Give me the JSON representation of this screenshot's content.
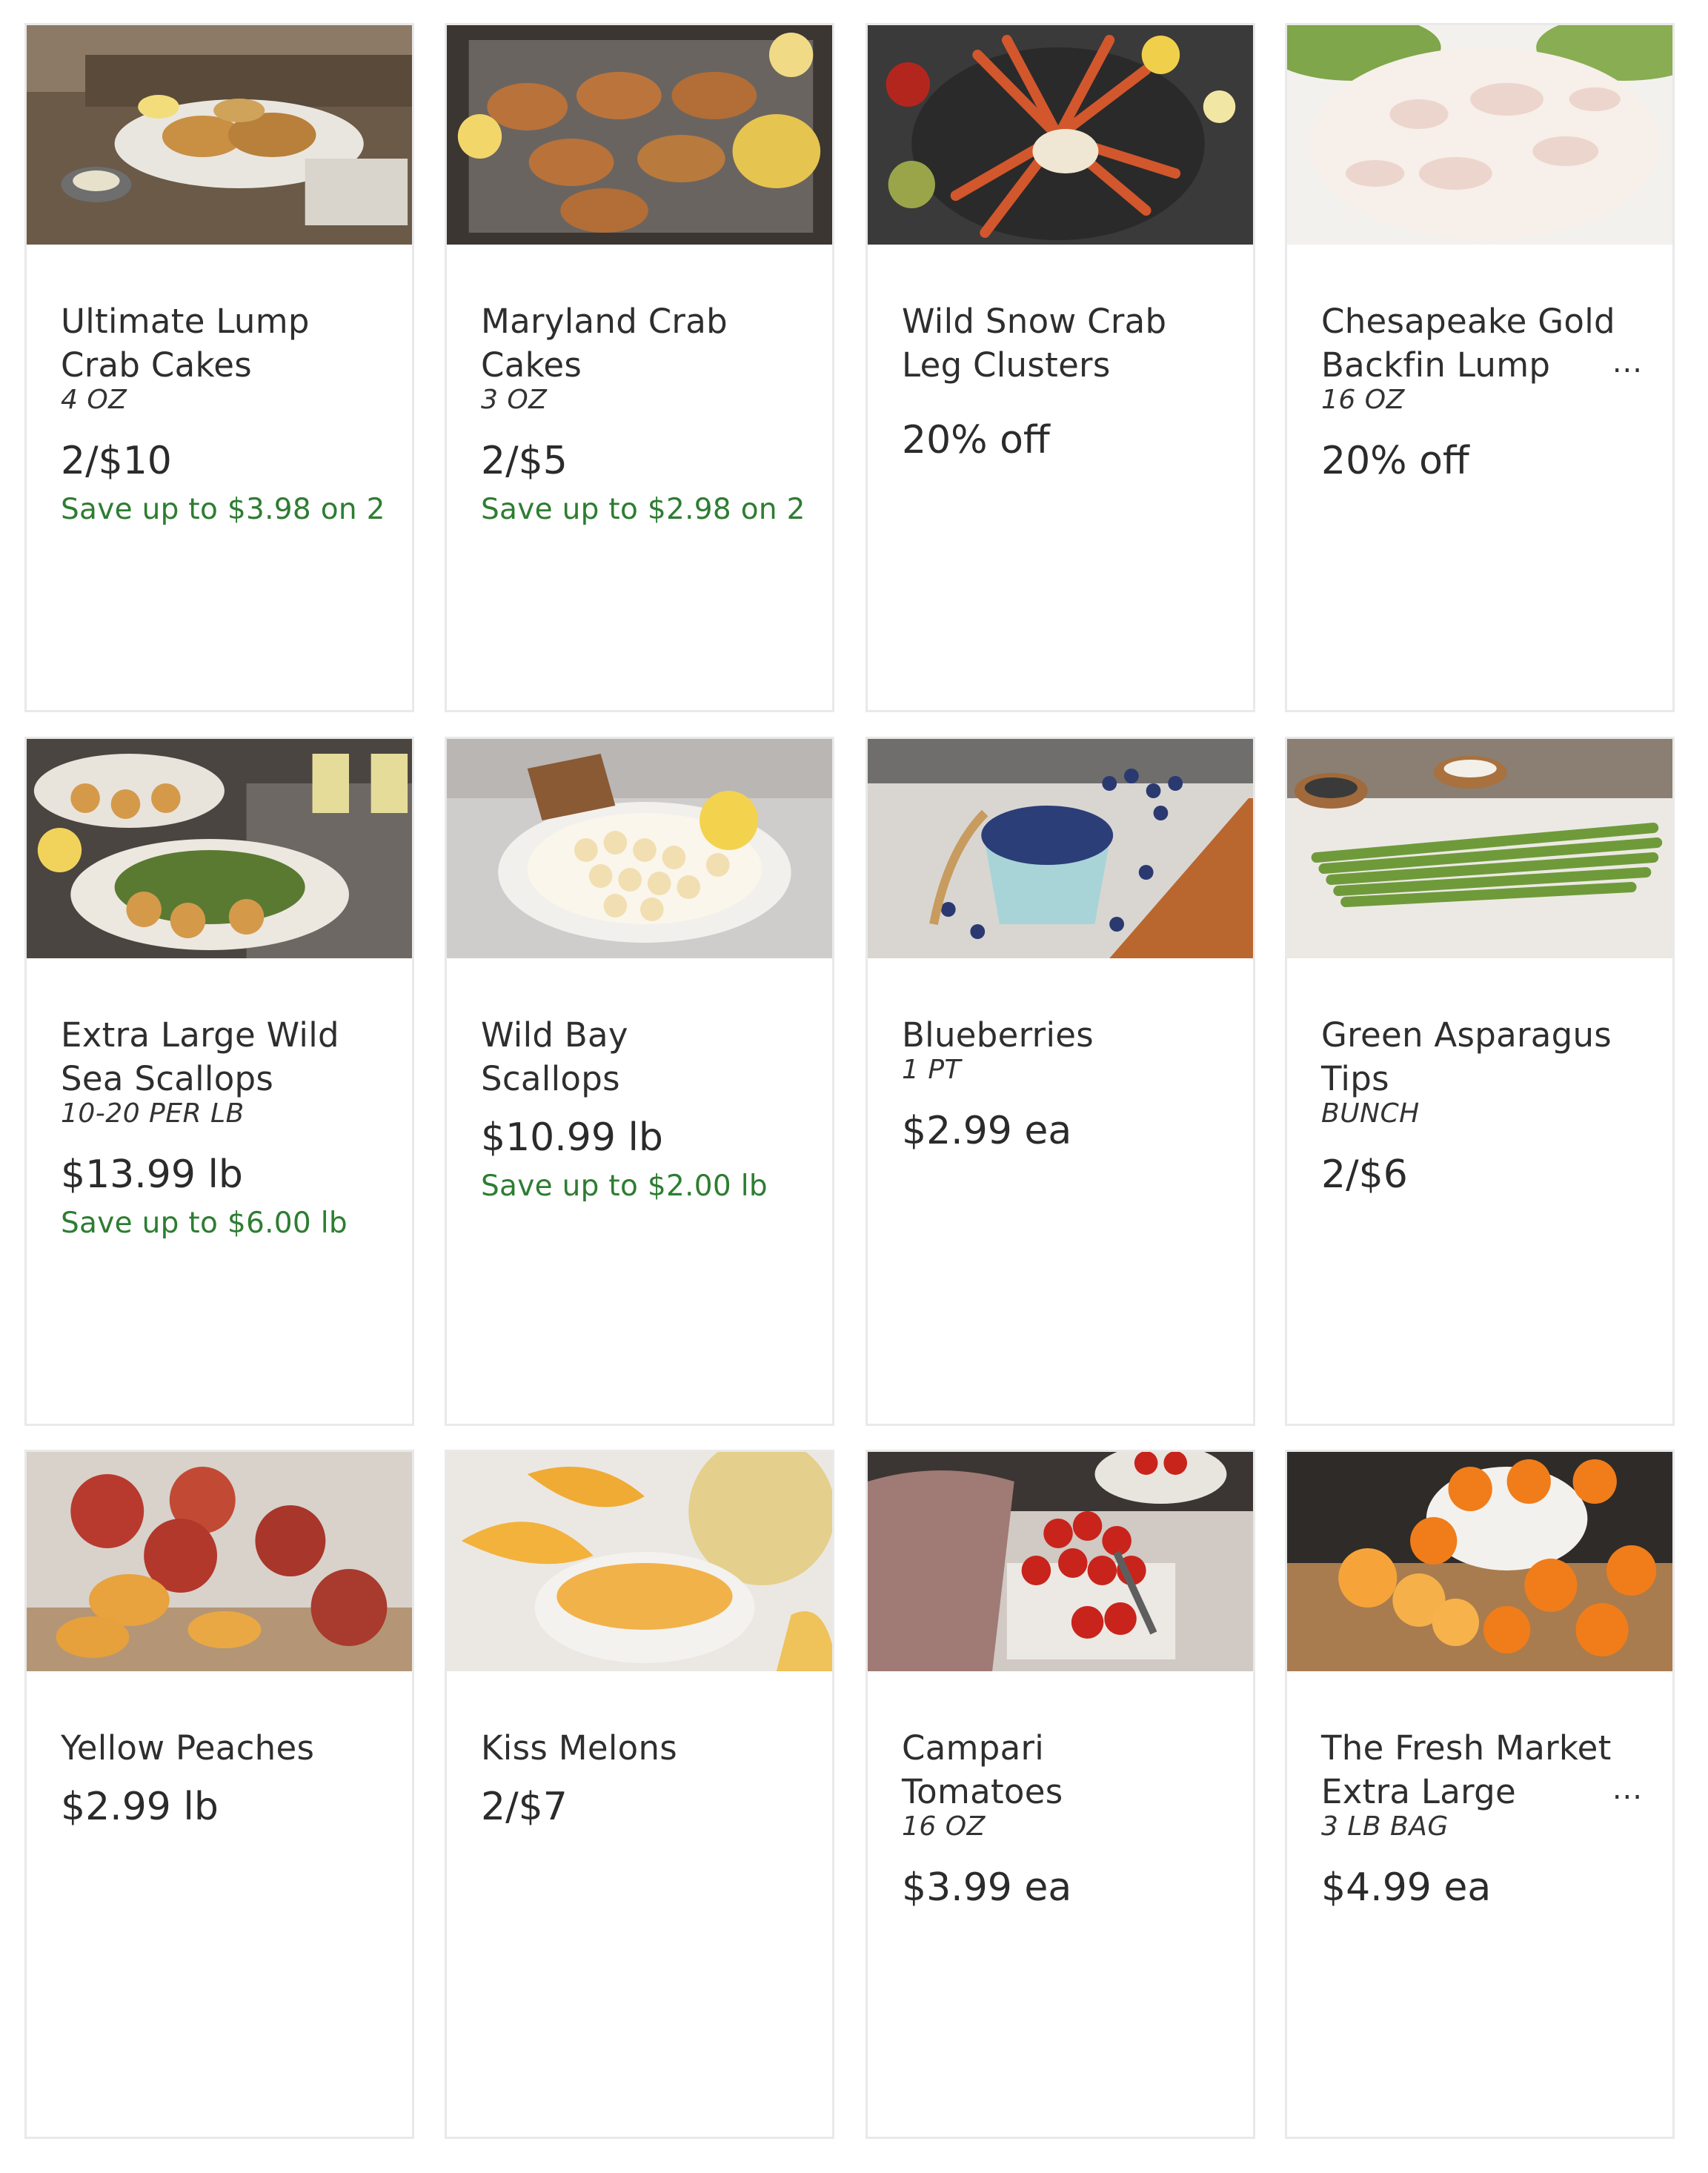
{
  "products": [
    {
      "title": "Ultimate Lump Crab Cakes",
      "size": "4 OZ",
      "price": "2/$10",
      "save": "Save up to $3.98 on 2",
      "image_icon": "crab-cakes-plate-image"
    },
    {
      "title": "Maryland Crab Cakes",
      "size": "3 OZ",
      "price": "2/$5",
      "save": "Save up to $2.98 on 2",
      "image_icon": "crab-cakes-tray-image"
    },
    {
      "title": "Wild Snow Crab Leg Clusters",
      "size": "",
      "price": "20% off",
      "save": "",
      "image_icon": "snow-crab-legs-image"
    },
    {
      "title": "Chesapeake Gold Backfin Lump",
      "size": "16 OZ",
      "price": "20% off",
      "save": "",
      "more": "...",
      "image_icon": "crab-meat-image"
    },
    {
      "title": "Extra Large Wild Sea Scallops",
      "size": "10-20 PER LB",
      "price": "$13.99 lb",
      "save": "Save up to $6.00 lb",
      "image_icon": "sea-scallops-salad-image"
    },
    {
      "title": "Wild Bay Scallops",
      "size": "",
      "price": "$10.99 lb",
      "save": "Save up to $2.00 lb",
      "image_icon": "bay-scallops-plate-image"
    },
    {
      "title": "Blueberries",
      "size": "1 PT",
      "price": "$2.99 ea",
      "save": "",
      "image_icon": "blueberries-bowl-image"
    },
    {
      "title": "Green Asparagus Tips",
      "size": "BUNCH",
      "price": "2/$6",
      "save": "",
      "image_icon": "asparagus-image"
    },
    {
      "title": "Yellow Peaches",
      "size": "",
      "price": "$2.99 lb",
      "save": "",
      "image_icon": "peaches-image"
    },
    {
      "title": "Kiss Melons",
      "size": "",
      "price": "2/$7",
      "save": "",
      "image_icon": "melons-image"
    },
    {
      "title": "Campari Tomatoes",
      "size": "16 OZ",
      "price": "$3.99 ea",
      "save": "",
      "image_icon": "tomatoes-image"
    },
    {
      "title": "The Fresh Market Extra Large",
      "size": "3 LB BAG",
      "price": "$4.99 ea",
      "save": "",
      "more": "...",
      "image_icon": "mandarins-image"
    }
  ],
  "colors": {
    "save_green": "#2e7d32",
    "card_border": "#e9e9e9",
    "text": "#2b2b2b"
  }
}
